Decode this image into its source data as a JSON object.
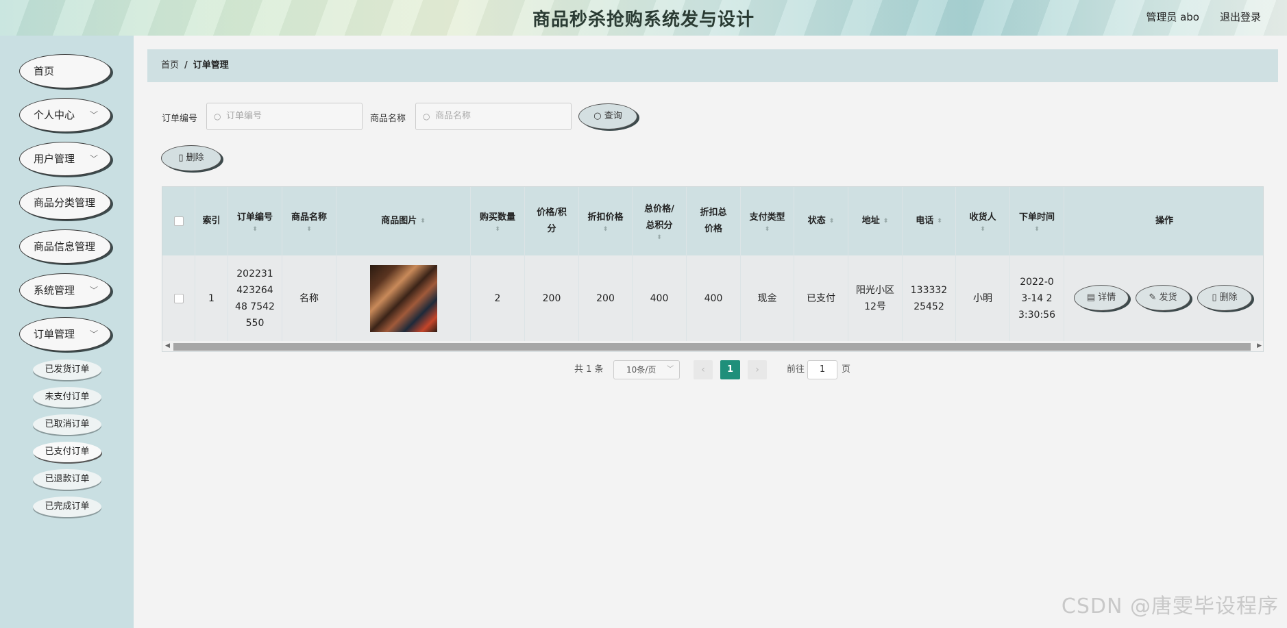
{
  "header": {
    "title": "商品秒杀抢购系统发与设计",
    "user": "管理员 abo",
    "logout": "退出登录"
  },
  "sidebar": {
    "items": [
      {
        "label": "首页",
        "chevron": false
      },
      {
        "label": "个人中心",
        "chevron": true
      },
      {
        "label": "用户管理",
        "chevron": true
      },
      {
        "label": "商品分类管理",
        "chevron": false
      },
      {
        "label": "商品信息管理",
        "chevron": false
      },
      {
        "label": "系统管理",
        "chevron": true
      },
      {
        "label": "订单管理",
        "chevron": true
      }
    ],
    "subitems": [
      "已发货订单",
      "未支付订单",
      "已取消订单",
      "已支付订单",
      "已退款订单",
      "已完成订单"
    ],
    "active_sub": "已支付订单"
  },
  "breadcrumb": {
    "home": "首页",
    "sep": "/",
    "current": "订单管理"
  },
  "filters": {
    "order_no_label": "订单编号",
    "order_no_placeholder": "订单编号",
    "product_label": "商品名称",
    "product_placeholder": "商品名称",
    "search_button": "查询"
  },
  "toolbar": {
    "delete_button": "删除"
  },
  "table": {
    "headers": [
      "索引",
      "订单编号",
      "商品名称",
      "商品图片",
      "购买数量",
      "价格/积分",
      "折扣价格",
      "总价格/总积分",
      "折扣总价格",
      "支付类型",
      "状态",
      "地址",
      "电话",
      "收货人",
      "下单时间",
      "操作"
    ],
    "rows": [
      {
        "index": "1",
        "order_no": "20223142326448 7542550",
        "product_name": "名称",
        "quantity": "2",
        "price": "200",
        "discount_price": "200",
        "total_price": "400",
        "discount_total": "400",
        "pay_type": "现金",
        "status": "已支付",
        "address": "阳光小区12号",
        "phone": "13333225452",
        "receiver": "小明",
        "order_time": "2022-03-14 23:30:56",
        "ops": {
          "detail": "详情",
          "ship": "发货",
          "delete": "删除"
        }
      }
    ]
  },
  "pagination": {
    "total": "共 1 条",
    "page_size": "10条/页",
    "current": "1",
    "goto_label": "前往",
    "goto_value": "1",
    "page_unit": "页"
  },
  "watermark": "CSDN @唐雯毕设程序",
  "colors": {
    "accent": "#1f8f7a",
    "sidebar": "#c9dfe2",
    "header_row": "#cfe0e2"
  }
}
